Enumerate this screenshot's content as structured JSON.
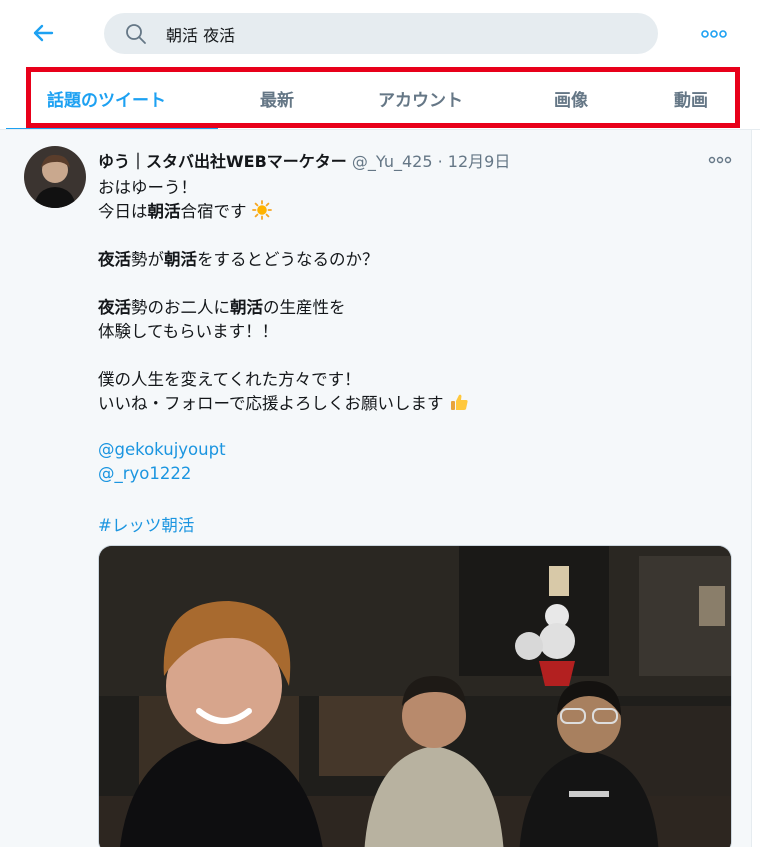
{
  "search": {
    "query": "朝活 夜活"
  },
  "tabs": [
    {
      "label": "話題のツイート",
      "active": true
    },
    {
      "label": "最新",
      "active": false
    },
    {
      "label": "アカウント",
      "active": false
    },
    {
      "label": "画像",
      "active": false
    },
    {
      "label": "動画",
      "active": false
    }
  ],
  "colors": {
    "accent": "#1da1f2",
    "highlight_border": "#e8001a",
    "link": "#1b95e0"
  },
  "tweet": {
    "name": "ゆう｜スタバ出社WEBマーケター",
    "handle": "@_Yu_425",
    "separator": "·",
    "date": "12月9日",
    "lines": {
      "l1": "おはゆーう！",
      "l2_pre": "今日は",
      "l2_bold": "朝活",
      "l2_post": "合宿です",
      "l3_bold1": "夜活",
      "l3_mid1": "勢が",
      "l3_bold2": "朝活",
      "l3_post": "をするとどうなるのか？",
      "l4_bold1": "夜活",
      "l4_mid": "勢のお二人に",
      "l4_bold2": "朝活",
      "l4_post": "の生産性を",
      "l5": "体験してもらいます！！",
      "l6": "僕の人生を変えてくれた方々です！",
      "l7": "いいね・フォローで応援よろしくお願いします"
    },
    "mentions": [
      "@gekokujyoupt",
      "@_ryo1222"
    ],
    "hashtag": "#レッツ朝活",
    "emoji_icons": [
      "sun-emoji",
      "thumbs-up-emoji"
    ],
    "photo_subject": "three-people-selfie-photo"
  }
}
